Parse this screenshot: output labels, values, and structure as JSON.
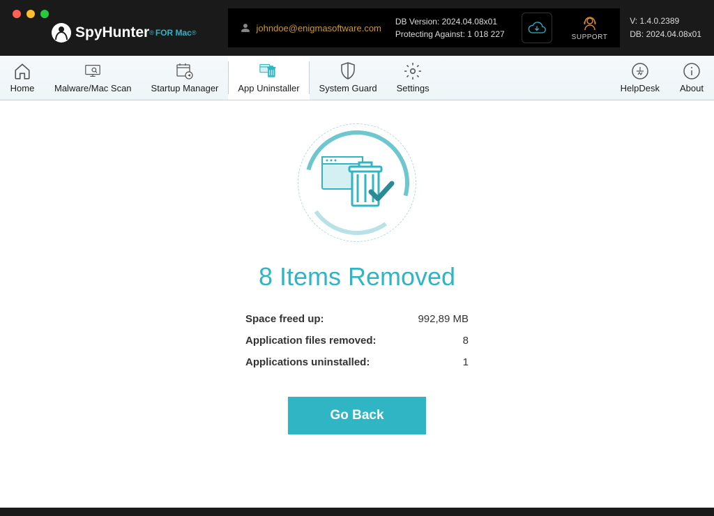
{
  "header": {
    "logo_main": "SpyHunter",
    "logo_sub": "FOR Mac",
    "user_email": "johndoe@enigmasoftware.com",
    "db_version_label": "DB Version: 2024.04.08x01",
    "protecting_label": "Protecting Against: 1 018 227",
    "support_label": "SUPPORT",
    "version_line1": "V: 1.4.0.2389",
    "version_line2": "DB:  2024.04.08x01"
  },
  "toolbar": {
    "home": "Home",
    "scan": "Malware/Mac Scan",
    "startup": "Startup Manager",
    "uninstaller": "App Uninstaller",
    "guard": "System Guard",
    "settings": "Settings",
    "helpdesk": "HelpDesk",
    "about": "About"
  },
  "result": {
    "title": "8 Items Removed",
    "rows": [
      {
        "label": "Space freed up:",
        "value": "992,89 MB"
      },
      {
        "label": "Application files removed:",
        "value": "8"
      },
      {
        "label": "Applications uninstalled:",
        "value": "1"
      }
    ],
    "go_back": "Go Back"
  }
}
